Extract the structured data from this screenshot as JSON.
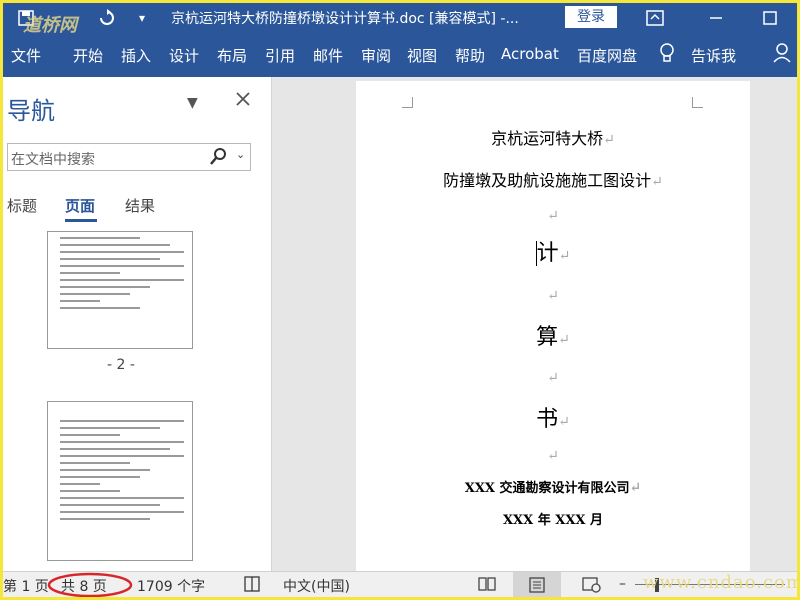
{
  "titlebar": {
    "title": "京杭运河特大桥防撞桥墩设计计算书.doc [兼容模式] -...",
    "login": "登录"
  },
  "ribbon": {
    "tabs": [
      "文件",
      "开始",
      "插入",
      "设计",
      "布局",
      "引用",
      "邮件",
      "审阅",
      "视图",
      "帮助",
      "Acrobat",
      "百度网盘"
    ],
    "tell_me": "告诉我"
  },
  "nav": {
    "title": "导航",
    "search_placeholder": "在文档中搜索",
    "tabs": [
      "标题",
      "页面",
      "结果"
    ],
    "active_tab": "页面",
    "thumb_page_label": "- 2 -"
  },
  "document": {
    "line1": "京杭运河特大桥",
    "line2": "防撞墩及助航设施施工图设计",
    "char1": "计",
    "char2": "算",
    "char3": "书",
    "company": "XXX 交通勘察设计有限公司",
    "date": "XXX 年 XXX 月",
    "para_mark": "↵"
  },
  "status": {
    "page_of": "第 1 页",
    "total_pages": "共 8 页",
    "word_count": "1709 个字",
    "language": "中文(中国)",
    "zoom_minus": "–"
  },
  "watermark": {
    "top_left": "道桥网",
    "bottom_right": "www.cndao.com"
  },
  "colors": {
    "accent": "#2b579a",
    "frame": "#f5e63a",
    "highlight_circle": "#d8262a"
  }
}
